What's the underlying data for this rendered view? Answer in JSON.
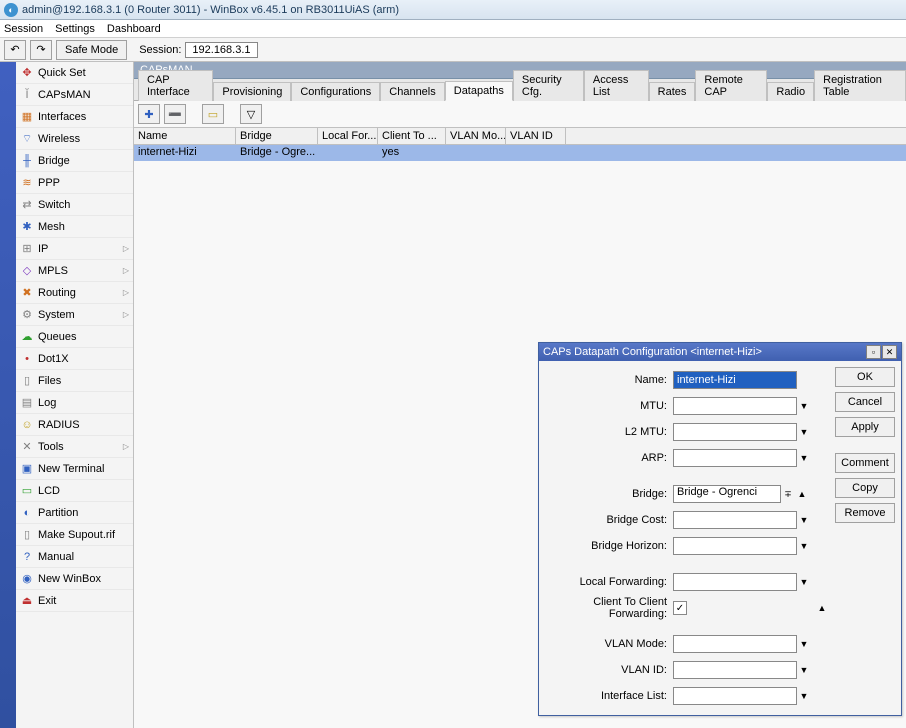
{
  "window": {
    "title": "admin@192.168.3.1 (0 Router 3011) - WinBox v6.45.1 on RB3011UiAS (arm)"
  },
  "menu": {
    "items": [
      "Session",
      "Settings",
      "Dashboard"
    ]
  },
  "toolbar": {
    "safe_mode": "Safe Mode",
    "session_label": "Session:",
    "session_ip": "192.168.3.1"
  },
  "sidebar": {
    "items": [
      {
        "icon": "✥",
        "cls": "ic-red",
        "label": "Quick Set"
      },
      {
        "icon": "Ĭ",
        "cls": "ic-gray",
        "label": "CAPsMAN"
      },
      {
        "icon": "▦",
        "cls": "ic-orange",
        "label": "Interfaces"
      },
      {
        "icon": "⌔",
        "cls": "ic-blue",
        "label": "Wireless"
      },
      {
        "icon": "╫",
        "cls": "ic-blue",
        "label": "Bridge"
      },
      {
        "icon": "≋",
        "cls": "ic-orange",
        "label": "PPP"
      },
      {
        "icon": "⇄",
        "cls": "ic-gray",
        "label": "Switch"
      },
      {
        "icon": "✱",
        "cls": "ic-blue",
        "label": "Mesh"
      },
      {
        "icon": "⊞",
        "cls": "ic-gray",
        "label": "IP",
        "sub": true
      },
      {
        "icon": "◇",
        "cls": "ic-purple",
        "label": "MPLS",
        "sub": true
      },
      {
        "icon": "✖",
        "cls": "ic-orange",
        "label": "Routing",
        "sub": true
      },
      {
        "icon": "⚙",
        "cls": "ic-gray",
        "label": "System",
        "sub": true
      },
      {
        "icon": "☁",
        "cls": "ic-green",
        "label": "Queues"
      },
      {
        "icon": "•",
        "cls": "ic-red",
        "label": "Dot1X"
      },
      {
        "icon": "▯",
        "cls": "ic-gray",
        "label": "Files"
      },
      {
        "icon": "▤",
        "cls": "ic-gray",
        "label": "Log"
      },
      {
        "icon": "☺",
        "cls": "ic-yellow",
        "label": "RADIUS"
      },
      {
        "icon": "✕",
        "cls": "ic-gray",
        "label": "Tools",
        "sub": true
      },
      {
        "icon": "▣",
        "cls": "ic-blue",
        "label": "New Terminal"
      },
      {
        "icon": "▭",
        "cls": "ic-green",
        "label": "LCD"
      },
      {
        "icon": "◐",
        "cls": "ic-blue",
        "label": "Partition"
      },
      {
        "icon": "▯",
        "cls": "ic-gray",
        "label": "Make Supout.rif"
      },
      {
        "icon": "?",
        "cls": "ic-blue",
        "label": "Manual"
      },
      {
        "icon": "◉",
        "cls": "ic-blue",
        "label": "New WinBox"
      },
      {
        "icon": "⏏",
        "cls": "ic-red",
        "label": "Exit"
      }
    ]
  },
  "panel": {
    "title": "CAPsMAN",
    "tabs": [
      "CAP Interface",
      "Provisioning",
      "Configurations",
      "Channels",
      "Datapaths",
      "Security Cfg.",
      "Access List",
      "Rates",
      "Remote CAP",
      "Radio",
      "Registration Table"
    ],
    "active_tab": 4,
    "columns": [
      "Name",
      "Bridge",
      "Local For...",
      "Client To ...",
      "VLAN Mo...",
      "VLAN ID"
    ],
    "rows": [
      {
        "name": "internet-Hizi",
        "bridge": "Bridge - Ogre...",
        "local": "",
        "client": "yes",
        "vlanm": "",
        "vlanid": ""
      }
    ],
    "add_glyph": "✚",
    "remove_glyph": "➖",
    "comment_glyph": "▭",
    "filter_glyph": "▽"
  },
  "dialog": {
    "title": "CAPs Datapath Configuration <internet-Hizi>",
    "buttons": {
      "ok": "OK",
      "cancel": "Cancel",
      "apply": "Apply",
      "comment": "Comment",
      "copy": "Copy",
      "remove": "Remove"
    },
    "labels": {
      "name": "Name:",
      "mtu": "MTU:",
      "l2mtu": "L2 MTU:",
      "arp": "ARP:",
      "bridge": "Bridge:",
      "bridge_cost": "Bridge Cost:",
      "bridge_horizon": "Bridge Horizon:",
      "local_fwd": "Local Forwarding:",
      "client_fwd": "Client To Client Forwarding:",
      "vlan_mode": "VLAN Mode:",
      "vlan_id": "VLAN ID:",
      "iface_list": "Interface List:"
    },
    "values": {
      "name": "internet-Hizi",
      "bridge": "Bridge - Ogrenci",
      "client_fwd_checked": "✓",
      "dd": "∓"
    }
  }
}
